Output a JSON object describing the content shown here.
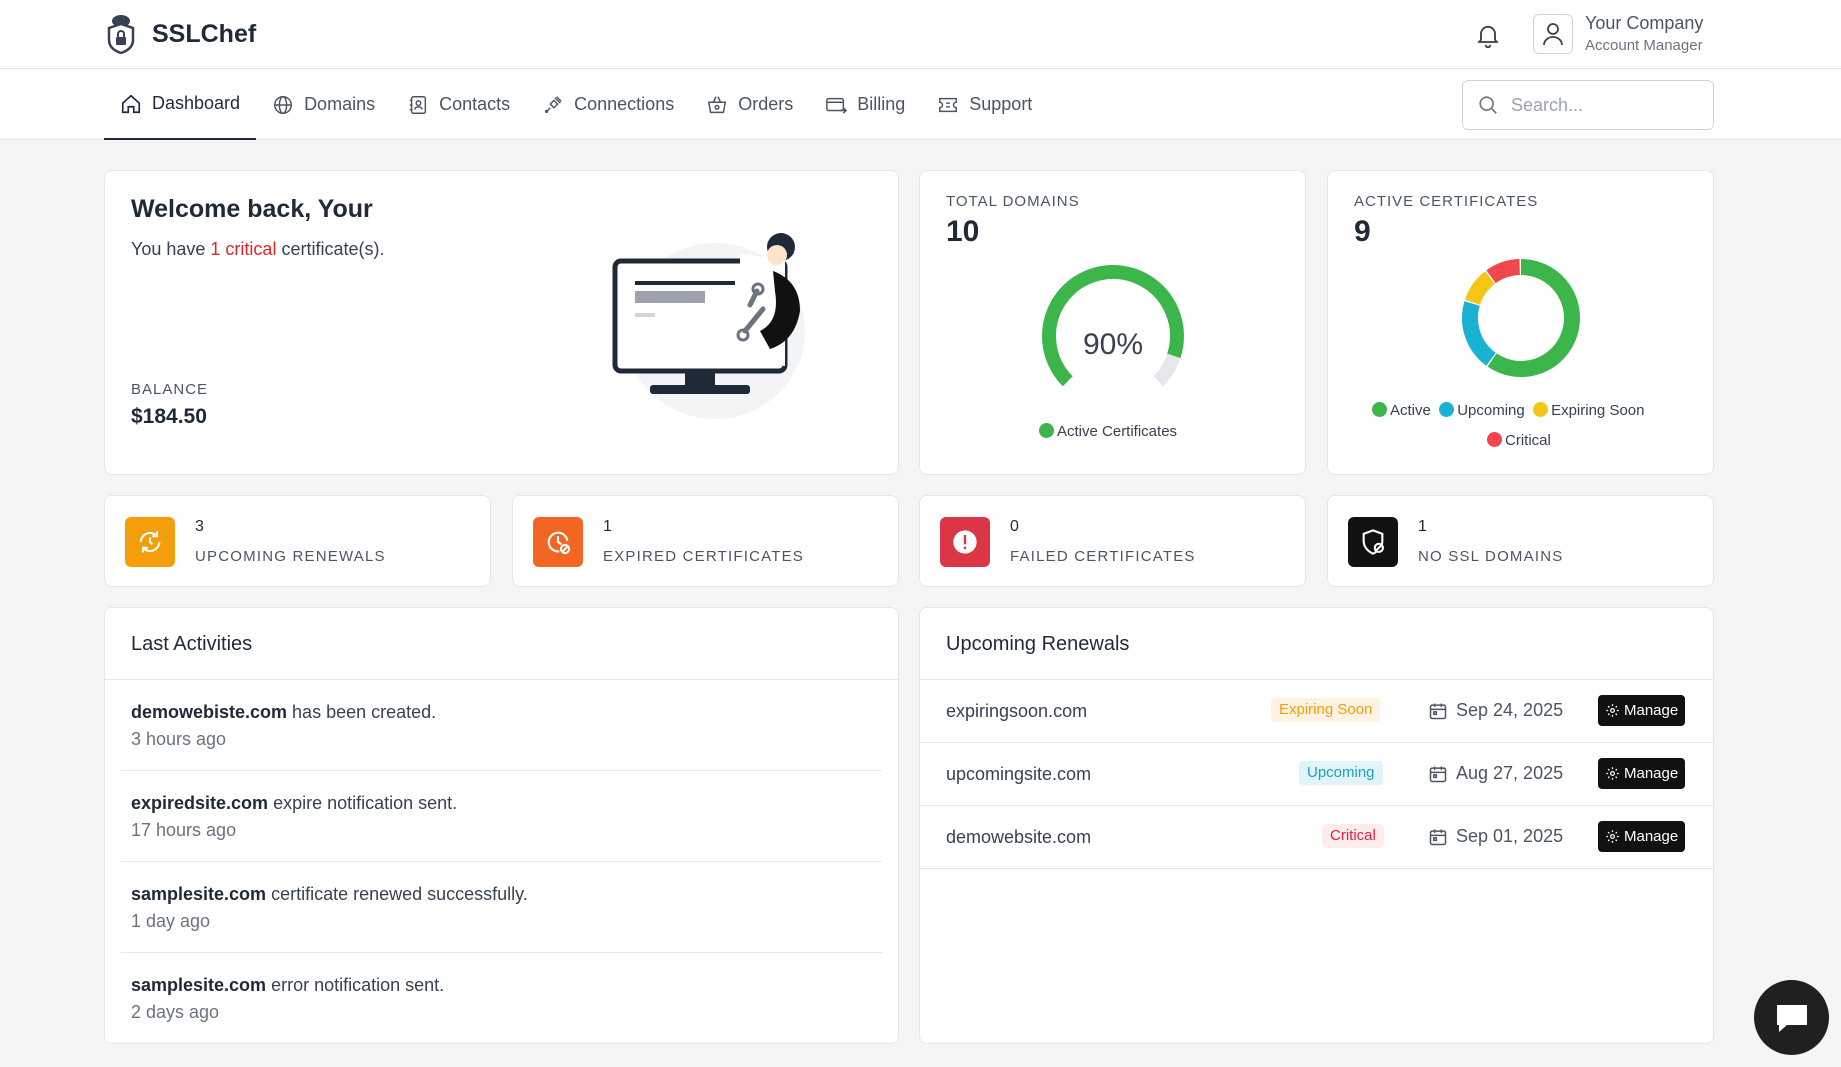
{
  "app": {
    "name": "SSLChef"
  },
  "user": {
    "name": "Your Company",
    "role": "Account Manager"
  },
  "nav": [
    {
      "label": "Dashboard",
      "icon": "home-icon",
      "active": true
    },
    {
      "label": "Domains",
      "icon": "globe-icon"
    },
    {
      "label": "Contacts",
      "icon": "contacts-icon"
    },
    {
      "label": "Connections",
      "icon": "plug-icon"
    },
    {
      "label": "Orders",
      "icon": "basket-icon"
    },
    {
      "label": "Billing",
      "icon": "billing-icon"
    },
    {
      "label": "Support",
      "icon": "ticket-icon"
    }
  ],
  "search": {
    "placeholder": "Search..."
  },
  "welcome": {
    "title": "Welcome back, Your",
    "sub_prefix": "You have ",
    "sub_critical": "1 critical",
    "sub_suffix": " certificate(s).",
    "balance_label": "BALANCE",
    "balance_value": "$184.50"
  },
  "total_domains": {
    "title": "TOTAL DOMAINS",
    "value": "10",
    "gauge_text": "90%",
    "gauge_percent": 90,
    "legend": "Active Certificates",
    "legend_color": "#3cb54a"
  },
  "active_certs": {
    "title": "ACTIVE CERTIFICATES",
    "value": "9",
    "legend": [
      {
        "label": "Active",
        "color": "#3cb54a"
      },
      {
        "label": "Upcoming",
        "color": "#19b2d2"
      },
      {
        "label": "Expiring Soon",
        "color": "#f5c518"
      },
      {
        "label": "Critical",
        "color": "#f0474f"
      }
    ]
  },
  "chart_data": {
    "type": "pie",
    "categories": [
      "Active",
      "Upcoming",
      "Expiring Soon",
      "Critical"
    ],
    "values": [
      6,
      2,
      1,
      1
    ],
    "title": "",
    "legend_position": "bottom"
  },
  "stats": [
    {
      "value": "3",
      "label": "UPCOMING RENEWALS",
      "icon": "renew-icon",
      "color": "#f59e0b"
    },
    {
      "value": "1",
      "label": "EXPIRED CERTIFICATES",
      "icon": "clock-icon",
      "color": "#f26522"
    },
    {
      "value": "0",
      "label": "FAILED CERTIFICATES",
      "icon": "alert-icon",
      "color": "#dc3545"
    },
    {
      "value": "1",
      "label": "NO SSL DOMAINS",
      "icon": "shield-off-icon",
      "color": "#111111"
    }
  ],
  "activities": {
    "title": "Last Activities",
    "items": [
      {
        "domain": "demowebiste.com",
        "text": " has been created.",
        "time": "3 hours ago"
      },
      {
        "domain": "expiredsite.com",
        "text": " expire notification sent.",
        "time": "17 hours ago"
      },
      {
        "domain": "samplesite.com",
        "text": " certificate renewed successfully.",
        "time": "1 day ago"
      },
      {
        "domain": "samplesite.com",
        "text": " error notification sent.",
        "time": "2 days ago"
      }
    ]
  },
  "renewals": {
    "title": "Upcoming Renewals",
    "manage_label": "Manage",
    "rows": [
      {
        "domain": "expiringsoon.com",
        "status": "Expiring Soon",
        "date": "Sep 24, 2025"
      },
      {
        "domain": "upcomingsite.com",
        "status": "Upcoming",
        "date": "Aug 27, 2025"
      },
      {
        "domain": "demowebsite.com",
        "status": "Critical",
        "date": "Sep 01, 2025"
      }
    ]
  }
}
